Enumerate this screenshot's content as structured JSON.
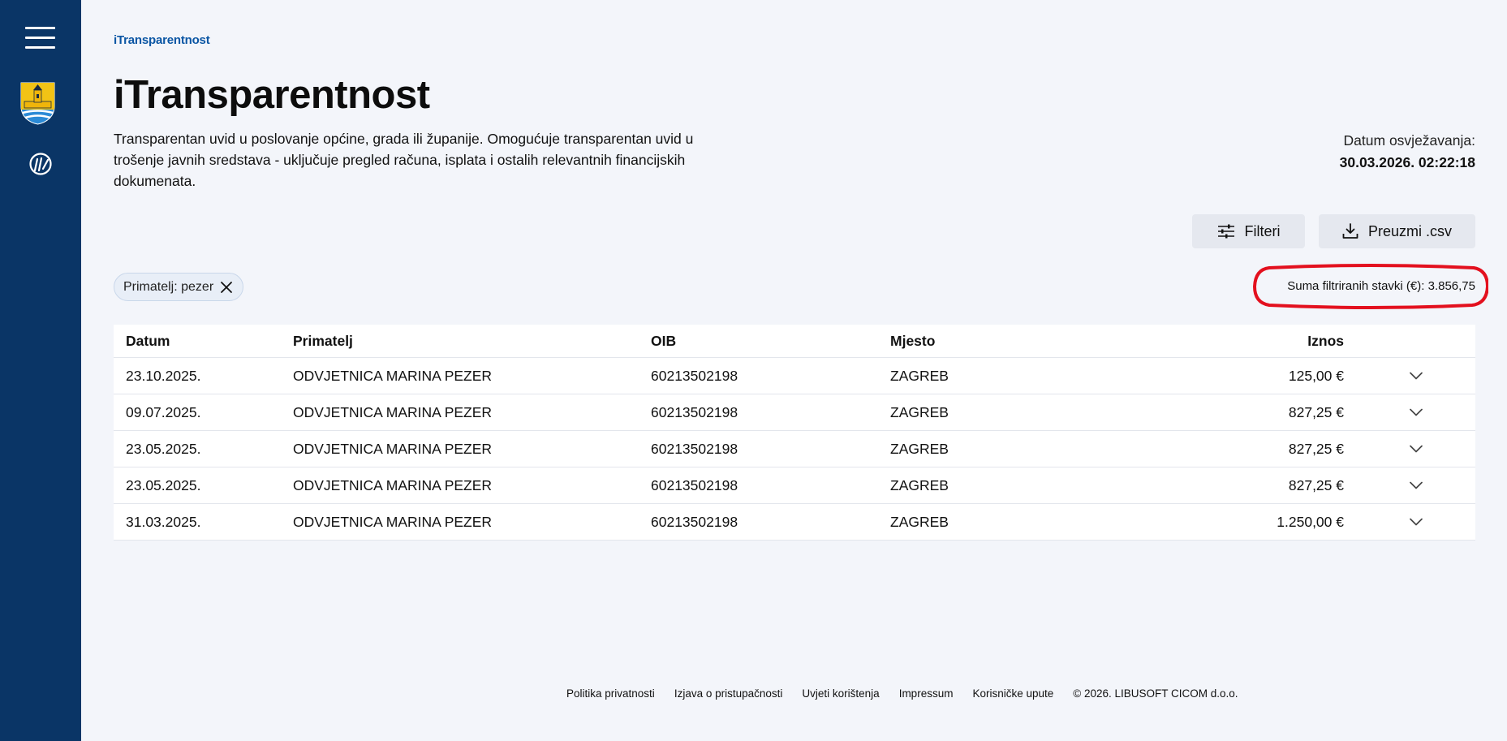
{
  "breadcrumb": "iTransparentnost",
  "title": "iTransparentnost",
  "description": "Transparentan uvid u poslovanje općine, grada ili županije. Omogućuje transparentan uvid u trošenje javnih sredstava - uključuje pregled računa, isplata i ostalih relevantnih financijskih dokumenata.",
  "refresh": {
    "label": "Datum osvježavanja:",
    "value": "30.03.2026. 02:22:18"
  },
  "buttons": {
    "filter_label": "Filteri",
    "download_label": "Preuzmi .csv"
  },
  "chip": {
    "label": "Primatelj: pezer"
  },
  "sum": {
    "text": "Suma filtriranih stavki (€): 3.856,75"
  },
  "table": {
    "headers": {
      "date": "Datum",
      "recipient": "Primatelj",
      "oib": "OIB",
      "place": "Mjesto",
      "amount": "Iznos"
    },
    "rows": [
      {
        "date": "23.10.2025.",
        "recipient": "ODVJETNICA MARINA PEZER",
        "oib": "60213502198",
        "place": "ZAGREB",
        "amount": "125,00 €"
      },
      {
        "date": "09.07.2025.",
        "recipient": "ODVJETNICA MARINA PEZER",
        "oib": "60213502198",
        "place": "ZAGREB",
        "amount": "827,25 €"
      },
      {
        "date": "23.05.2025.",
        "recipient": "ODVJETNICA MARINA PEZER",
        "oib": "60213502198",
        "place": "ZAGREB",
        "amount": "827,25 €"
      },
      {
        "date": "23.05.2025.",
        "recipient": "ODVJETNICA MARINA PEZER",
        "oib": "60213502198",
        "place": "ZAGREB",
        "amount": "827,25 €"
      },
      {
        "date": "31.03.2025.",
        "recipient": "ODVJETNICA MARINA PEZER",
        "oib": "60213502198",
        "place": "ZAGREB",
        "amount": "1.250,00 €"
      }
    ]
  },
  "footer": {
    "links": [
      "Politika privatnosti",
      "Izjava o pristupačnosti",
      "Uvjeti korištenja",
      "Impressum",
      "Korisničke upute"
    ],
    "copyright": "© 2026. LIBUSOFT CICOM d.o.o."
  },
  "colors": {
    "sidebar": "#0a3566",
    "accent": "#0b56a4",
    "background": "#f3f5fa",
    "highlight": "#e3101e"
  },
  "icons": {
    "menu": "hamburger-menu-icon",
    "crest": "municipality-crest-icon",
    "app": "itransparentnost-logo-icon",
    "filter": "sliders-icon",
    "download": "download-icon",
    "close": "close-icon",
    "expand": "chevron-down-icon"
  }
}
